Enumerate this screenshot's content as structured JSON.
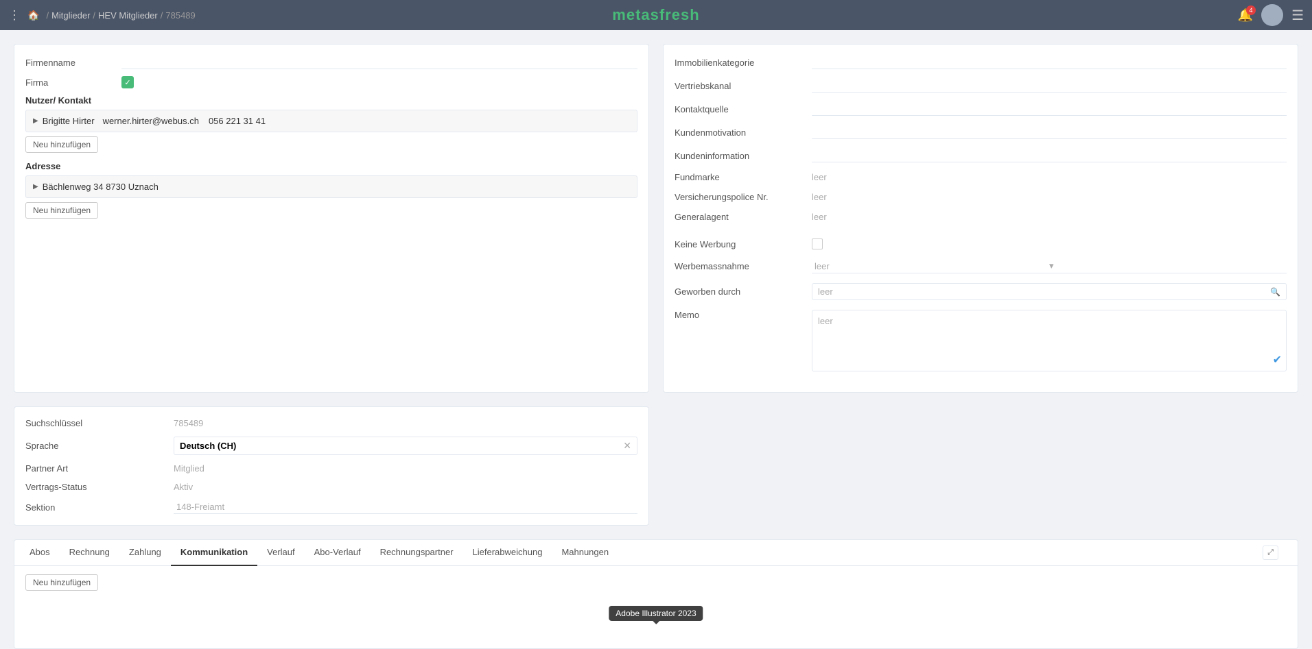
{
  "app": {
    "name": "metasfresh",
    "logo_color": "#48bb78"
  },
  "topnav": {
    "breadcrumbs": [
      "Mitglieder",
      "HEV Mitglieder",
      "785489"
    ],
    "notification_count": "4"
  },
  "left_card": {
    "firmenname_label": "Firmenname",
    "firma_label": "Firma",
    "nutzer_kontakt_label": "Nutzer/ Kontakt",
    "contact": {
      "name": "Brigitte  Hirter",
      "email": "werner.hirter@webus.ch",
      "phone": "056 221 31 41"
    },
    "neu_label": "Neu hinzufügen",
    "adresse_label": "Adresse",
    "address": {
      "text": "Bächlenweg 34 8730 Uznach"
    },
    "neu2_label": "Neu hinzufügen"
  },
  "bottom_left": {
    "suchschluessel_label": "Suchschlüssel",
    "suchschluessel_value": "785489",
    "sprache_label": "Sprache",
    "sprache_value": "Deutsch (CH)",
    "partner_art_label": "Partner Art",
    "partner_art_value": "Mitglied",
    "vertrags_status_label": "Vertrags-Status",
    "vertrags_status_value": "Aktiv",
    "sektion_label": "Sektion",
    "sektion_value": "148-Freiamt"
  },
  "right_card": {
    "immobilienkategorie_label": "Immobilienkategorie",
    "vertriebskanal_label": "Vertriebskanal",
    "kontaktquelle_label": "Kontaktquelle",
    "kundenmotivation_label": "Kundenmotivation",
    "kundeninformation_label": "Kundeninformation",
    "fundmarke_label": "Fundmarke",
    "fundmarke_value": "leer",
    "versicherungspolice_label": "Versicherungspolice Nr.",
    "versicherungspolice_value": "leer",
    "generalagent_label": "Generalagent",
    "generalagent_value": "leer",
    "keine_werbung_label": "Keine Werbung",
    "werbemassnahme_label": "Werbemassnahme",
    "werbemassnahme_value": "leer",
    "geworben_durch_label": "Geworben durch",
    "geworben_durch_value": "leer",
    "memo_label": "Memo",
    "memo_value": "leer"
  },
  "tabs": {
    "items": [
      {
        "label": "Abos",
        "active": false
      },
      {
        "label": "Rechnung",
        "active": false
      },
      {
        "label": "Zahlung",
        "active": false
      },
      {
        "label": "Kommunikation",
        "active": true
      },
      {
        "label": "Verlauf",
        "active": false
      },
      {
        "label": "Abo-Verlauf",
        "active": false
      },
      {
        "label": "Rechnungspartner",
        "active": false
      },
      {
        "label": "Lieferabweichung",
        "active": false
      },
      {
        "label": "Mahnungen",
        "active": false
      }
    ],
    "neu_label": "Neu hinzufügen"
  },
  "tooltip": {
    "text": "Adobe Illustrator 2023"
  }
}
